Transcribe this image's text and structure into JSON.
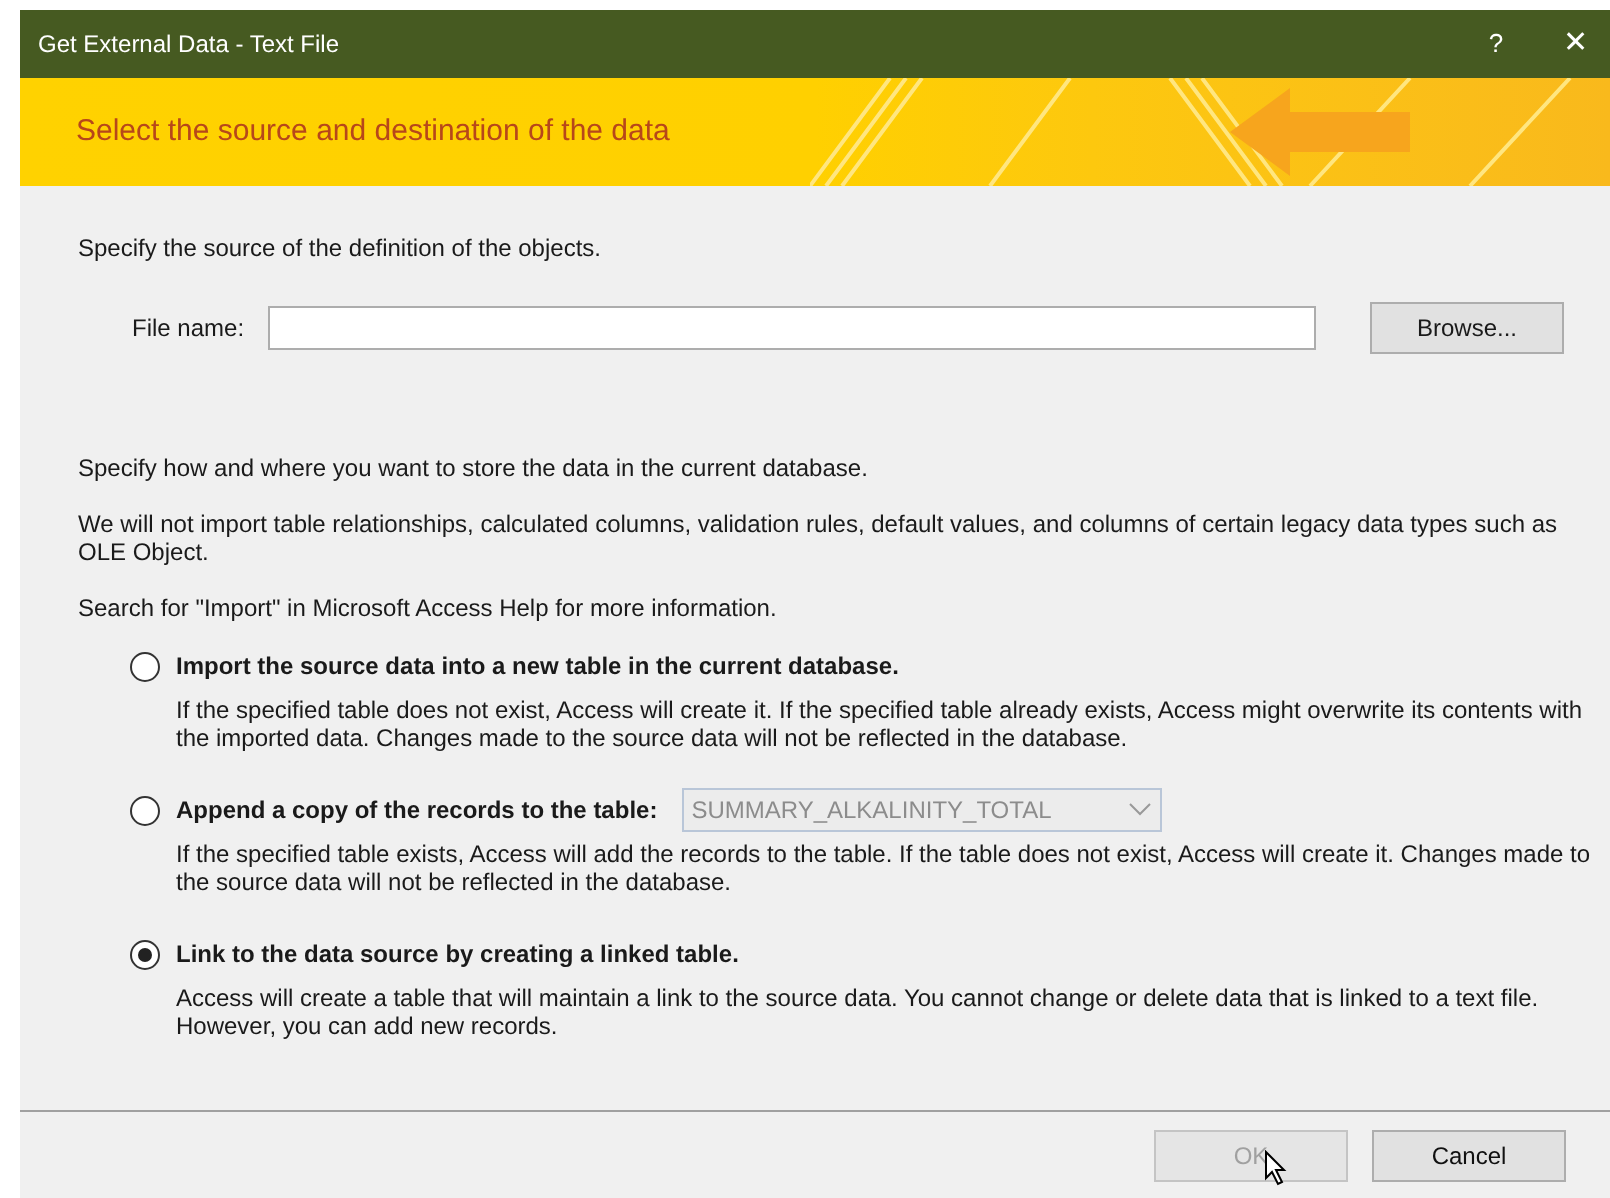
{
  "window": {
    "title": "Get External Data - Text File",
    "help": "?",
    "close": "✕"
  },
  "banner": {
    "heading": "Select the source and destination of the data"
  },
  "source": {
    "intro": "Specify the source of the definition of the objects.",
    "file_label": "File name:",
    "browse": "Browse..."
  },
  "destination": {
    "intro": "Specify how and where you want to store the data in the current database.",
    "note": "We will not import table relationships, calculated columns, validation rules, default values, and columns of certain legacy data types such as OLE Object.",
    "help": "Search for \"Import\" in Microsoft Access Help for more information."
  },
  "options": [
    {
      "kind": "plain",
      "label": "Import the source data into a new table in the current database.",
      "selected": false,
      "description": "If the specified table does not exist, Access will create it. If the specified table already exists, Access might overwrite its contents with the imported data. Changes made to the source data will not be reflected in the database."
    },
    {
      "kind": "combo",
      "label": "Append a copy of the records to the table:",
      "selected": false,
      "combo": {
        "value": "SUMMARY_ALKALINITY_TOTAL",
        "disabled": true
      },
      "description": "If the specified table exists, Access will add the records to the table. If the table does not exist, Access will create it. Changes made to the source data will not be reflected in the database."
    },
    {
      "kind": "plain",
      "label": "Link to the data source by creating a linked table.",
      "selected": true,
      "description": "Access will create a table that will maintain a link to the source data. You cannot change or delete data that is linked to a text file. However, you can add new records."
    }
  ],
  "buttons": [
    {
      "label": "OK",
      "disabled": true
    },
    {
      "label": "Cancel",
      "disabled": false
    }
  ]
}
